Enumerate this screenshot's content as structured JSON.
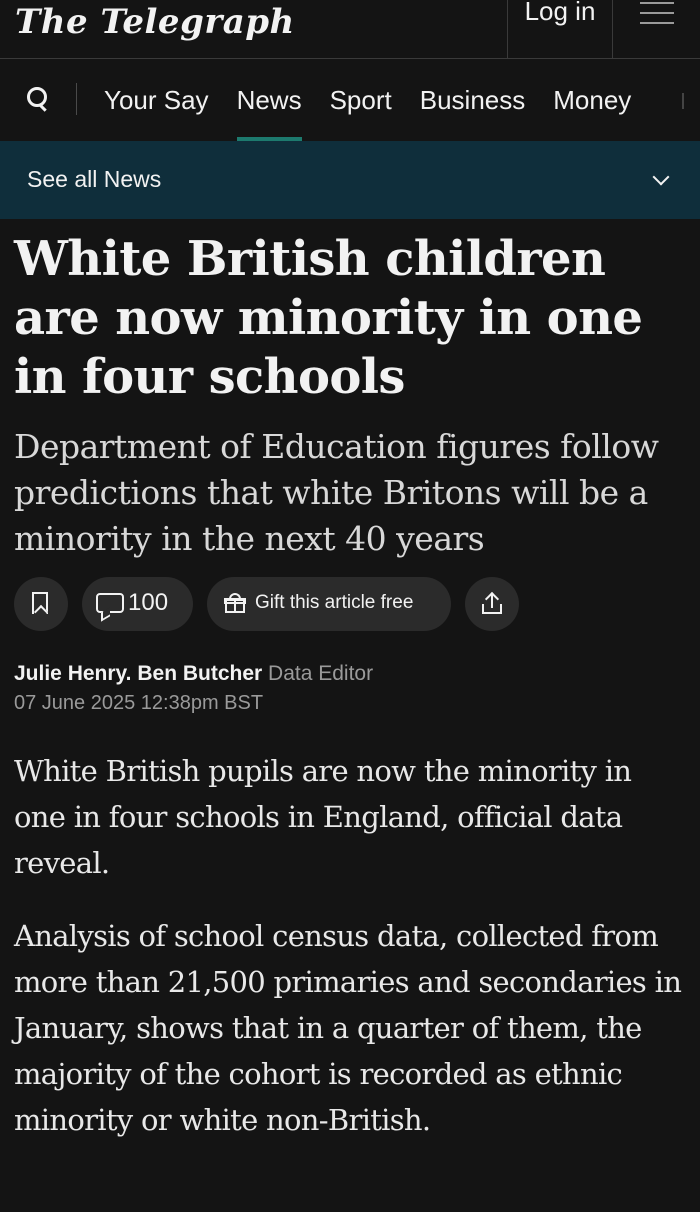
{
  "header": {
    "logo_text": "The Telegraph",
    "login_label": "Log in",
    "menu_icon": "hamburger-icon"
  },
  "nav": {
    "search_icon": "search-icon",
    "items": [
      {
        "label": "Your Say",
        "active": false
      },
      {
        "label": "News",
        "active": true
      },
      {
        "label": "Sport",
        "active": false
      },
      {
        "label": "Business",
        "active": false
      },
      {
        "label": "Money",
        "active": false
      }
    ],
    "accent_color": "#1d7a6e"
  },
  "section_bar": {
    "label": "See all News",
    "background": "#0f2e3b"
  },
  "article": {
    "headline": "White British children are now minority in one in four schools",
    "standfirst": "Department of Education figures follow predictions that white Britons will be a minority in the next 40 years",
    "actions": {
      "comment_count": "100",
      "gift_label": "Gift this article free"
    },
    "byline": {
      "author_1": "Julie Henry.",
      "author_2": "Ben Butcher",
      "role": "Data Editor",
      "date": "07 June 2025 12:38pm BST"
    },
    "paragraphs": [
      "White British pupils are now the minority in one in four schools in England, official data reveal.",
      "Analysis of school census data, collected from more than 21,500 primaries and secondaries in January, shows that in a quarter of them, the majority of the cohort is recorded as ethnic minority or white non-British."
    ]
  }
}
